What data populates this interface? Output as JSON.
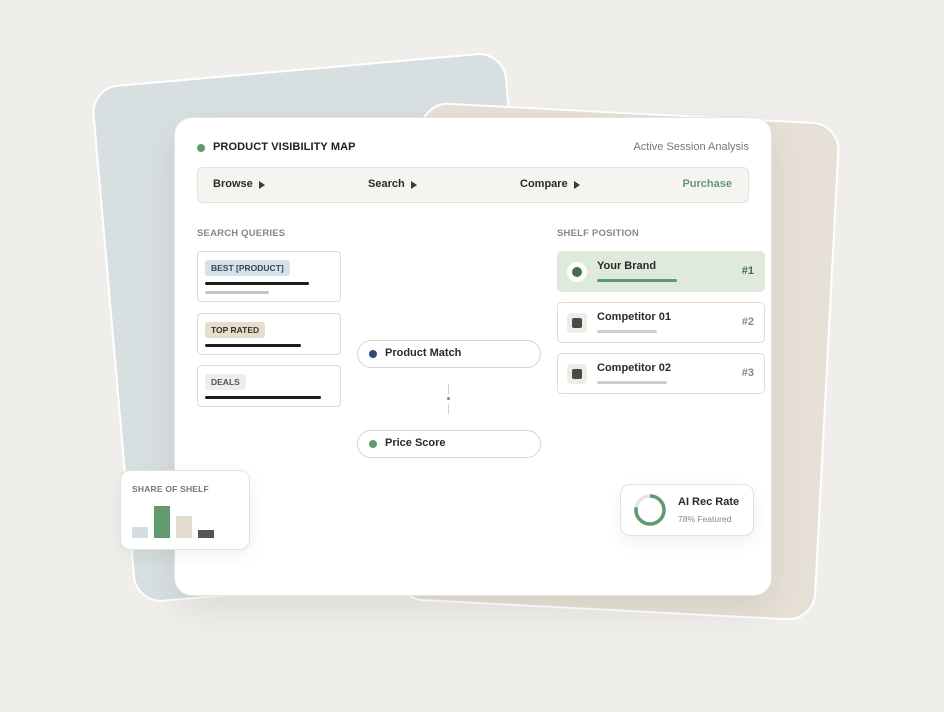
{
  "header": {
    "title": "PRODUCT VISIBILITY MAP",
    "subtitle": "Active Session Analysis",
    "status_color": "#5f9a70"
  },
  "pipeline": {
    "steps": [
      "Browse",
      "Search",
      "Compare"
    ],
    "final_step": "Purchase",
    "final_color": "#5f9a70"
  },
  "search_queries": {
    "label": "SEARCH QUERIES",
    "items": [
      {
        "tag": "BEST [PRODUCT]",
        "tag_bg": "#d6e1e8",
        "tag_color": "#2c4a66"
      },
      {
        "tag": "TOP RATED",
        "tag_bg": "#e8dccd",
        "tag_color": "#3b3022"
      },
      {
        "tag": "DEALS",
        "tag_bg": "#eeede9",
        "tag_color": "#555555"
      }
    ]
  },
  "matching": {
    "product_match": {
      "label": "Product Match",
      "dot_color": "#2b4a7a"
    },
    "price_score": {
      "label": "Price Score",
      "dot_color": "#5f9a70"
    }
  },
  "shelf": {
    "label": "SHELF POSITION",
    "items": [
      {
        "name": "Your Brand",
        "rank": "#1",
        "icon": "brand-circle-icon",
        "rank_color": "#3f6f4d",
        "bar_color": "#5f9a70"
      },
      {
        "name": "Competitor 01",
        "rank": "#2",
        "icon": "competitor-square-icon",
        "rank_color": "#8a8780",
        "bar_color": "#cfccc6"
      },
      {
        "name": "Competitor 02",
        "rank": "#3",
        "icon": "competitor-square-icon",
        "rank_color": "#8a8780",
        "bar_color": "#cfccc6"
      }
    ]
  },
  "share_of_shelf": {
    "title": "SHARE OF SHELF",
    "bars": [
      {
        "value": 0.34,
        "color": "#d5dde2"
      },
      {
        "value": 1.0,
        "color": "#5f9a70"
      },
      {
        "value": 0.69,
        "color": "#e4dbcf"
      },
      {
        "value": 0.25,
        "color": "#555555"
      }
    ]
  },
  "ai_rec": {
    "title": "AI Rec Rate",
    "subtitle": "78% Featured",
    "value": 0.78,
    "ring_color": "#5f9a70",
    "track_color": "#e6e4df"
  }
}
